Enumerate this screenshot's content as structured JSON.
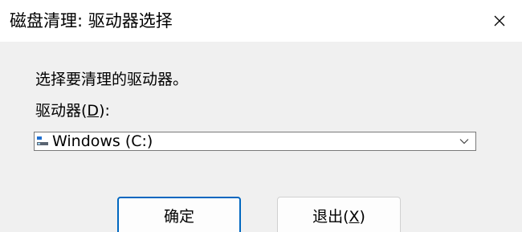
{
  "window": {
    "title": "磁盘清理: 驱动器选择"
  },
  "dialog": {
    "instruction": "选择要清理的驱动器。",
    "drive_label_prefix": "驱动器(",
    "drive_label_mnemonic": "D",
    "drive_label_suffix": "):",
    "selected_drive": "Windows (C:)"
  },
  "buttons": {
    "ok_label": "确定",
    "exit_label_prefix": "退出(",
    "exit_label_mnemonic": "X",
    "exit_label_suffix": ")"
  },
  "colors": {
    "titlebar_bg": "#ffffff",
    "body_bg": "#f0f0f0",
    "accent": "#0067c0",
    "text": "#000000"
  },
  "icons": {
    "close": "close-icon",
    "drive": "drive-icon",
    "dropdown": "chevron-down-icon"
  }
}
